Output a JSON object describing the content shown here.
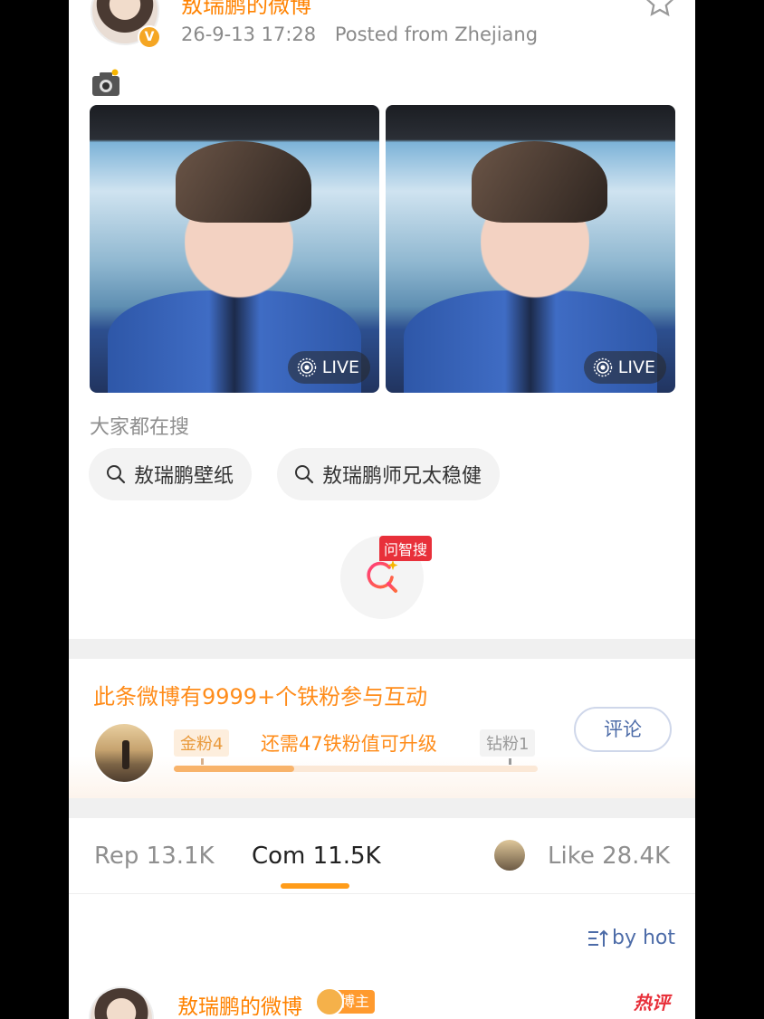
{
  "post": {
    "username": "敖瑞鹏的微博",
    "timestamp": "26-9-13 17:28",
    "location": "Posted from Zhejiang",
    "photos": [
      {
        "live_label": "LIVE"
      },
      {
        "live_label": "LIVE"
      }
    ]
  },
  "search": {
    "title": "大家都在搜",
    "chips": [
      "敖瑞鹏壁纸",
      "敖瑞鹏师兄太稳健"
    ],
    "ask_tag": "问智搜"
  },
  "fans": {
    "title": "此条微博有9999+个铁粉参与互动",
    "current_level": "金粉4",
    "message": "还需47铁粉值可升级",
    "next_level": "钻粉1",
    "progress": 0.33,
    "comment_button": "评论"
  },
  "tabs": {
    "repost": "Rep 13.1K",
    "comment": "Com 11.5K",
    "like": "Like 28.4K",
    "active": "comment"
  },
  "comments": {
    "sort_label": "by hot",
    "first": {
      "username": "敖瑞鹏的微博",
      "badge": "博主",
      "hot_label": "热评"
    }
  },
  "colors": {
    "accent": "#ff8200",
    "link": "#4d6ca8",
    "tab_indicator": "#ff9c1a",
    "hot": "#e8303a"
  }
}
